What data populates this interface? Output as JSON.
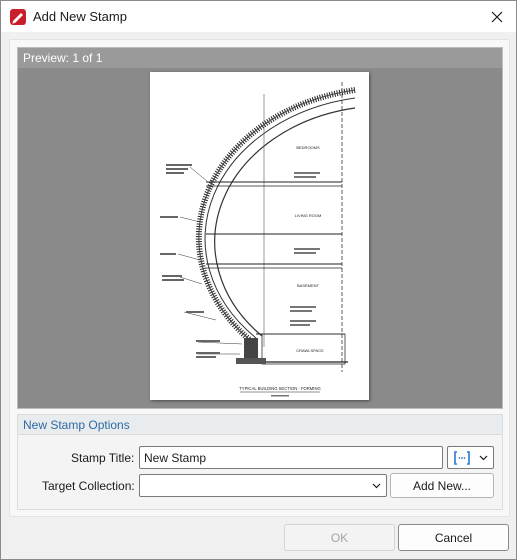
{
  "window": {
    "title": "Add New Stamp",
    "accent_color": "#c8202b"
  },
  "preview": {
    "label": "Preview: 1 of 1",
    "drawing": {
      "title": "TYPICAL BUILDING SECTION - FORMING",
      "rooms": [
        "BEDROOMS",
        "LIVING ROOM",
        "BASEMENT",
        "CRAWLSPACE"
      ]
    }
  },
  "options": {
    "group_label": "New Stamp Options",
    "stamp_title_label": "Stamp Title:",
    "stamp_title_value": "New Stamp",
    "stamp_title_placeholder": "",
    "target_collection_label": "Target Collection:",
    "target_collection_value": "",
    "add_new_label": "Add New...",
    "macro_icon": "insert-macro-icon"
  },
  "footer": {
    "ok_label": "OK",
    "cancel_label": "Cancel"
  }
}
